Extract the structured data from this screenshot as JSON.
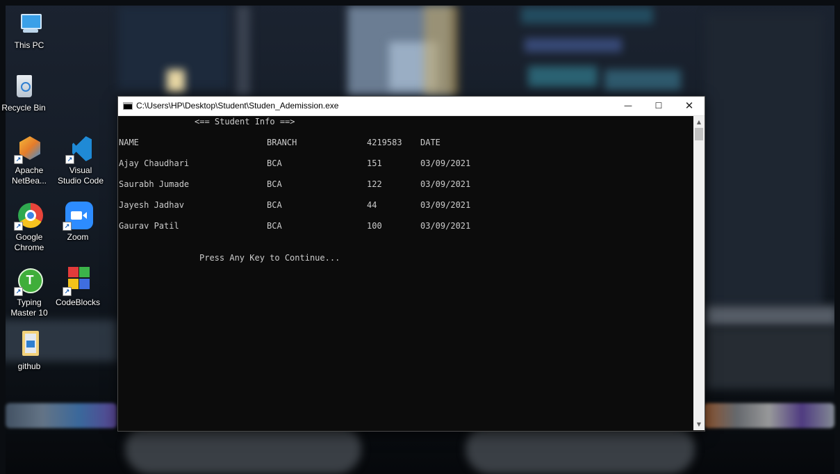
{
  "desktop": {
    "icons": [
      {
        "label": "This PC"
      },
      {
        "label": "Recycle Bin"
      },
      {
        "label": "Apache NetBea..."
      },
      {
        "label": "Visual Studio Code"
      },
      {
        "label": "Google Chrome"
      },
      {
        "label": "Zoom"
      },
      {
        "label": "Typing Master 10"
      },
      {
        "label": "CodeBlocks"
      },
      {
        "label": "github"
      }
    ]
  },
  "window": {
    "title": "C:\\Users\\HP\\Desktop\\Student\\Studen_Ademission.exe",
    "controls": {
      "minimize": "—",
      "maximize": "☐",
      "close": "✕"
    }
  },
  "console": {
    "heading": "<== Student Info ==>",
    "columns": [
      "NAME",
      "BRANCH",
      "4219583",
      "DATE"
    ],
    "rows": [
      [
        "Ajay Chaudhari",
        "BCA",
        "151",
        "03/09/2021"
      ],
      [
        "Saurabh Jumade",
        "BCA",
        "122",
        "03/09/2021"
      ],
      [
        "Jayesh Jadhav",
        "BCA",
        "44",
        "03/09/2021"
      ],
      [
        "Gaurav Patil",
        "BCA",
        "100",
        "03/09/2021"
      ]
    ],
    "prompt": "Press Any Key to Continue..."
  },
  "scrollbar": {
    "up_icon": "▲",
    "down_icon": "▼"
  },
  "colors": {
    "console_bg": "#0c0c0c",
    "console_text": "#cccccc",
    "titlebar_bg": "#ffffff"
  }
}
